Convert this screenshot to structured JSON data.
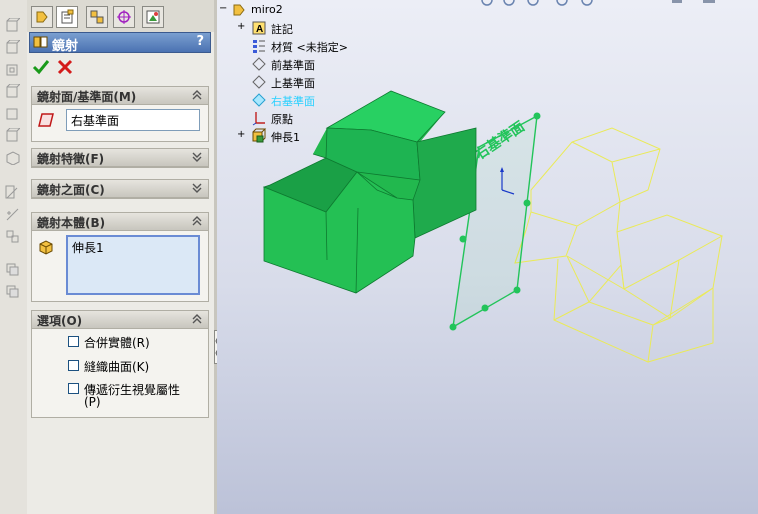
{
  "property_manager": {
    "title": "鏡射",
    "help": "?",
    "groups": {
      "mirror_plane": {
        "header": "鏡射面/基準面(M)",
        "value": "右基準面"
      },
      "mirror_features": {
        "header": "鏡射特徵(F)"
      },
      "mirror_faces": {
        "header": "鏡射之面(C)"
      },
      "bodies": {
        "header": "鏡射本體(B)",
        "items": [
          "伸長1"
        ]
      },
      "options": {
        "header": "選項(O)",
        "merge_solids": "合併實體(R)",
        "knit_surfaces": "縫織曲面(K)",
        "propagate_visual": "傳遞衍生視覺屬性",
        "propagate_visual_key": "(P)"
      }
    }
  },
  "feature_tree": {
    "root": "miro2",
    "items": [
      {
        "label": "註記",
        "icon": "annotations-icon"
      },
      {
        "label": "材質 <未指定>",
        "icon": "material-icon"
      },
      {
        "label": "前基準面",
        "icon": "plane-icon"
      },
      {
        "label": "上基準面",
        "icon": "plane-icon"
      },
      {
        "label": "右基準面",
        "icon": "plane-icon"
      },
      {
        "label": "原點",
        "icon": "origin-icon"
      },
      {
        "label": "伸長1",
        "icon": "extrude-icon"
      }
    ]
  },
  "viewport": {
    "plane_label": "右基準面"
  },
  "colors": {
    "preview_green": "#22c45a",
    "mirror_yellow": "#f0f060",
    "highlight": "#28d0ff",
    "title_blue": "#4b72b2"
  }
}
